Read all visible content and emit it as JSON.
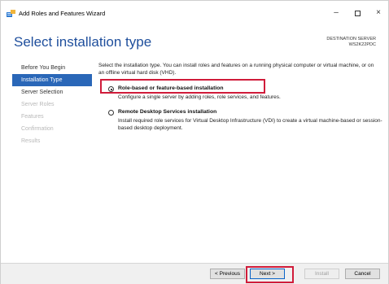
{
  "window": {
    "title": "Add Roles and Features Wizard",
    "controls": {
      "minimize": "–",
      "maximize": "",
      "close": "×"
    }
  },
  "header": {
    "title": "Select installation type",
    "destination_label": "DESTINATION SERVER",
    "destination_server": "WS2K22PDC"
  },
  "sidebar": {
    "items": [
      {
        "label": "Before You Begin",
        "state": "normal"
      },
      {
        "label": "Installation Type",
        "state": "active"
      },
      {
        "label": "Server Selection",
        "state": "normal"
      },
      {
        "label": "Server Roles",
        "state": "disabled"
      },
      {
        "label": "Features",
        "state": "disabled"
      },
      {
        "label": "Confirmation",
        "state": "disabled"
      },
      {
        "label": "Results",
        "state": "disabled"
      }
    ]
  },
  "main": {
    "intro": "Select the installation type. You can install roles and features on a running physical computer or virtual machine, or on an offline virtual hard disk (VHD).",
    "options": [
      {
        "title": "Role-based or feature-based installation",
        "description": "Configure a single server by adding roles, role services, and features.",
        "selected": true
      },
      {
        "title": "Remote Desktop Services installation",
        "description": "Install required role services for Virtual Desktop Infrastructure (VDI) to create a virtual machine-based or session-based desktop deployment.",
        "selected": false
      }
    ]
  },
  "buttons": {
    "previous": "< Previous",
    "next": "Next >",
    "install": "Install",
    "cancel": "Cancel"
  },
  "colors": {
    "title_blue": "#1e4e9c",
    "active_nav": "#2a67b8",
    "highlight_red": "#d01c3a"
  }
}
